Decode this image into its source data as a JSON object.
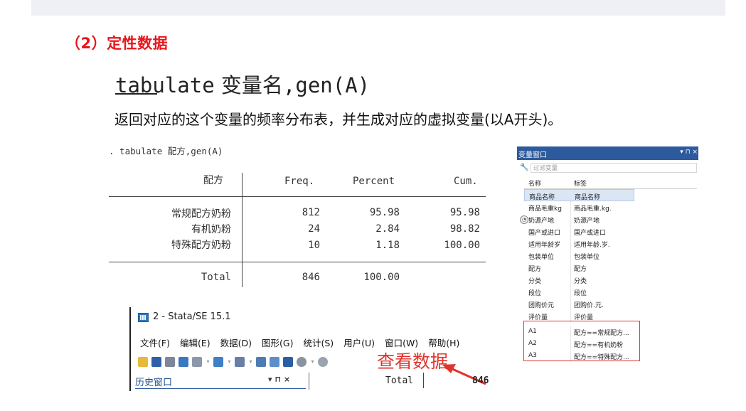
{
  "section_heading": "（2）定性数据",
  "command": {
    "cmd": "tabulate",
    "varname": " 变量名",
    "opt": ",gen(A)"
  },
  "description": "返回对应的这个变量的频率分布表，并生成对应的虚拟变量(以A开头)。",
  "stata_command": ". tabulate 配方,gen(A)",
  "freq_table": {
    "headers": [
      "配方",
      "Freq.",
      "Percent",
      "Cum."
    ],
    "rows": [
      {
        "label": "常规配方奶粉",
        "freq": "812",
        "percent": "95.98",
        "cum": "95.98"
      },
      {
        "label": "有机奶粉",
        "freq": "24",
        "percent": "2.84",
        "cum": "98.82"
      },
      {
        "label": "特殊配方奶粉",
        "freq": "10",
        "percent": "1.18",
        "cum": "100.00"
      }
    ],
    "total": {
      "label": "Total",
      "freq": "846",
      "percent": "100.00"
    }
  },
  "variable_window": {
    "title": "变量窗口",
    "controls": "▾ ⊓ ×",
    "filter_placeholder": "过滤变量",
    "col_name": "名称",
    "col_label": "标签",
    "variables": [
      {
        "name": "商品名称",
        "label": "商品名称"
      },
      {
        "name": "商品毛重kg",
        "label": "商品毛重.kg."
      },
      {
        "name": "奶源产地",
        "label": "奶源产地"
      },
      {
        "name": "国产或进口",
        "label": "国产或进口"
      },
      {
        "name": "适用年龄岁",
        "label": "适用年龄.岁."
      },
      {
        "name": "包装单位",
        "label": "包装单位"
      },
      {
        "name": "配方",
        "label": "配方"
      },
      {
        "name": "分类",
        "label": "分类"
      },
      {
        "name": "段位",
        "label": "段位"
      },
      {
        "name": "团购价元",
        "label": "团购价.元."
      },
      {
        "name": "评价量",
        "label": "评价量"
      },
      {
        "name": "A1",
        "label": "配方==常规配方..."
      },
      {
        "name": "A2",
        "label": "配方==有机奶粉"
      },
      {
        "name": "A3",
        "label": "配方==特殊配方..."
      }
    ]
  },
  "stata_window": {
    "title": "2 - Stata/SE 15.1",
    "menus": [
      "文件(F)",
      "编辑(E)",
      "数据(D)",
      "图形(G)",
      "统计(S)",
      "用户(U)",
      "窗口(W)",
      "帮助(H)"
    ],
    "view_data_label": "查看数据",
    "history_title": "历史窗口",
    "history_controls": "▾ ⊓ ×",
    "total_label": "Total",
    "total_value": "846"
  },
  "colors": {
    "heading_red": "#e8151b",
    "accent_red": "#e0342d",
    "window_blue": "#2c5a9c"
  }
}
